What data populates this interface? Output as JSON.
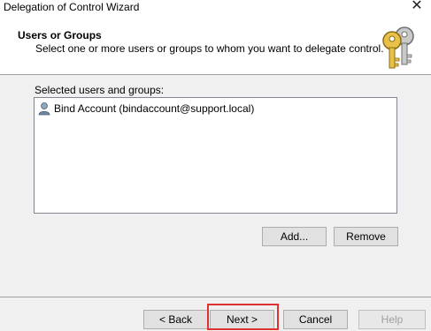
{
  "window": {
    "title": "Delegation of Control Wizard",
    "close_glyph": "✕"
  },
  "header": {
    "title": "Users or Groups",
    "subtitle": "Select one or more users or groups to whom you want to delegate control.",
    "icon": "keys-icon"
  },
  "selection": {
    "label": "Selected users and groups:",
    "items": [
      {
        "icon": "user-icon",
        "label": "Bind Account (bindaccount@support.local)"
      }
    ]
  },
  "actions": {
    "add_label": "Add...",
    "remove_label": "Remove"
  },
  "footer": {
    "back_label": "< Back",
    "next_label": "Next >",
    "cancel_label": "Cancel",
    "help_label": "Help"
  },
  "colors": {
    "highlight": "#e03131"
  }
}
